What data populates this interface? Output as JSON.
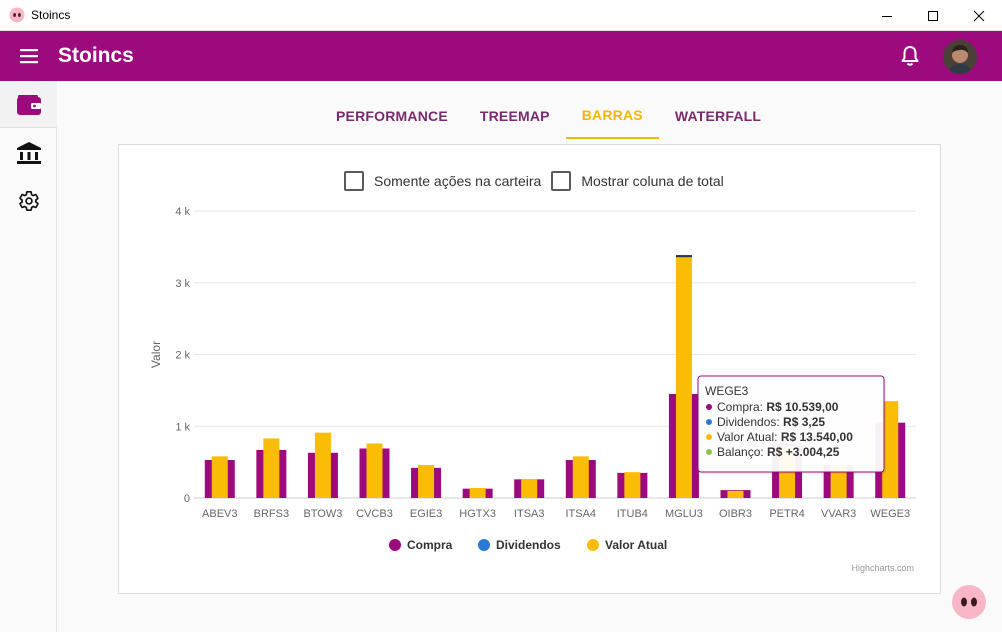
{
  "window": {
    "title": "Stoincs"
  },
  "appbar": {
    "title": "Stoincs"
  },
  "tabs": [
    {
      "label": "PERFORMANCE",
      "active": false
    },
    {
      "label": "TREEMAP",
      "active": false
    },
    {
      "label": "BARRAS",
      "active": true
    },
    {
      "label": "WATERFALL",
      "active": false
    }
  ],
  "options": {
    "only_portfolio": "Somente ações na carteira",
    "show_total": "Mostrar coluna de total"
  },
  "colors": {
    "primary": "#9c0a7e",
    "accent": "#f2b705",
    "compra": "#9c0a7e",
    "dividendos": "#2979d6",
    "valor_atual": "#fbbc05",
    "balanco": "#8bc34a"
  },
  "chart_data": {
    "type": "bar",
    "ylabel": "Valor",
    "ylim": [
      0,
      4000
    ],
    "yticks": [
      "0",
      "1 k",
      "2 k",
      "3 k",
      "4 k"
    ],
    "categories": [
      "ABEV3",
      "BRFS3",
      "BTOW3",
      "CVCB3",
      "EGIE3",
      "HGTX3",
      "ITSA3",
      "ITSA4",
      "ITUB4",
      "MGLU3",
      "OIBR3",
      "PETR4",
      "VVAR3",
      "WEGE3"
    ],
    "series": [
      {
        "name": "Compra",
        "values": [
          530,
          670,
          630,
          690,
          420,
          130,
          260,
          530,
          350,
          1450,
          110,
          760,
          460,
          1050
        ]
      },
      {
        "name": "Dividendos",
        "values": [
          0,
          0,
          0,
          0,
          0,
          0,
          0,
          0,
          0,
          30,
          0,
          0,
          0,
          0
        ]
      },
      {
        "name": "Valor Atual",
        "values": [
          580,
          830,
          910,
          760,
          460,
          140,
          260,
          580,
          360,
          3370,
          100,
          720,
          460,
          1350
        ]
      }
    ],
    "legend": {
      "placement": "bottom",
      "items": [
        "Compra",
        "Dividendos",
        "Valor Atual"
      ]
    },
    "credits": "Highcharts.com",
    "tooltip": {
      "title": "WEGE3",
      "rows": [
        {
          "label": "Compra: ",
          "value": "R$ 10.539,00",
          "color": "#9c0a7e"
        },
        {
          "label": "Dividendos: ",
          "value": "R$ 3,25",
          "color": "#2979d6"
        },
        {
          "label": "Valor Atual: ",
          "value": "R$ 13.540,00",
          "color": "#fbbc05"
        },
        {
          "label": "Balanço: ",
          "value": "R$ +3.004,25",
          "color": "#8bc34a"
        }
      ]
    }
  }
}
